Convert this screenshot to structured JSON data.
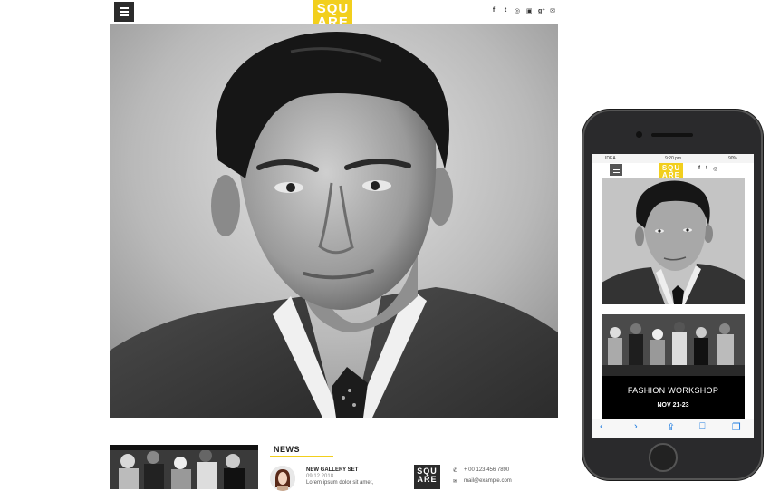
{
  "desktop": {
    "logo": {
      "line1": "SQU",
      "line2": "ARE"
    },
    "social_icons": [
      "facebook-icon",
      "twitter-icon",
      "instagram-icon",
      "flickr-icon",
      "google-plus-icon",
      "mail-icon"
    ],
    "social_glyphs": [
      "f",
      "t",
      "◎",
      "▣",
      "g⁺",
      "✉"
    ],
    "news": {
      "heading": "NEWS",
      "item_title": "NEW GALLERY SET",
      "item_date": "09.12.2018",
      "item_text": "Lorem ipsum dolor sit amet,"
    },
    "footer_logo": {
      "line1": "SQU",
      "line2": "ARE"
    },
    "contact": {
      "phone_icon": "✆",
      "phone": "+ 00 123 456 7890",
      "mail_icon": "✉",
      "email": "mail@example.com"
    }
  },
  "mobile": {
    "status": {
      "carrier": "IDEA",
      "time": "9:20 pm",
      "battery": "90%"
    },
    "logo": {
      "line1": "SQU",
      "line2": "ARE"
    },
    "social_glyphs": [
      "f",
      "t",
      "◎"
    ],
    "event": {
      "title": "FASHION WORKSHOP",
      "date": "NOV 21-23"
    },
    "toolbar": [
      "back-icon",
      "forward-icon",
      "share-icon",
      "bookmarks-icon",
      "tabs-icon"
    ],
    "toolbar_glyphs": [
      "‹",
      "›",
      "⇪",
      "⎕",
      "❐"
    ]
  },
  "colors": {
    "brand_yellow": "#f2cf1d",
    "dark": "#2b2b2b",
    "ios_blue": "#1f7ce0"
  }
}
